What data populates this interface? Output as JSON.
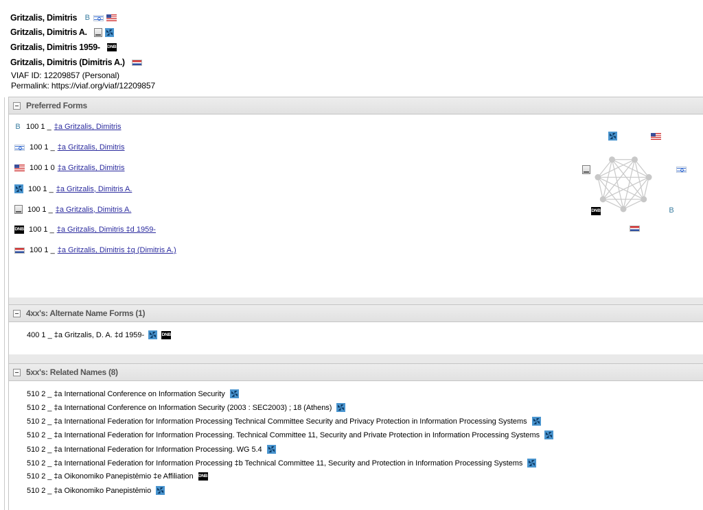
{
  "header": {
    "names": [
      {
        "text": "Gritzalis, Dimitris",
        "icons": [
          "b-icon",
          "israel-flag-icon",
          "usa-flag-icon"
        ]
      },
      {
        "text": "Gritzalis, Dimitris A.",
        "icons": [
          "book-icon",
          "lc-icon"
        ]
      },
      {
        "text": "Gritzalis, Dimitris 1959-",
        "icons": [
          "dnb-icon"
        ]
      },
      {
        "text": "Gritzalis, Dimitris (Dimitris A.)",
        "icons": [
          "netherlands-flag-icon"
        ]
      }
    ],
    "viaf_id": "VIAF ID: 12209857 (Personal)",
    "permalink": "Permalink: https://viaf.org/viaf/12209857"
  },
  "preferred_forms": {
    "title": "Preferred Forms",
    "rows": [
      {
        "icon": "b-icon",
        "code": "100 1 _",
        "link": "‡a  Gritzalis, Dimitris"
      },
      {
        "icon": "israel-flag-icon",
        "code": "100 1 _",
        "link": "‡a  Gritzalis, Dimitris"
      },
      {
        "icon": "usa-flag-icon",
        "code": "100 1 0",
        "link": "‡a  Gritzalis, Dimitris"
      },
      {
        "icon": "lc-icon",
        "code": "100 1 _",
        "link": "‡a  Gritzalis, Dimitris A."
      },
      {
        "icon": "book-icon",
        "code": "100 1 _",
        "link": "‡a  Gritzalis, Dimitris A."
      },
      {
        "icon": "dnb-icon",
        "code": "100 1 _",
        "link": "‡a  Gritzalis, Dimitris ‡d  1959-"
      },
      {
        "icon": "netherlands-flag-icon",
        "code": "100 1 _",
        "link": "‡a  Gritzalis, Dimitris ‡q  (Dimitris A.)"
      }
    ],
    "graph": {
      "b_label": "B",
      "dnb_label": "DNB"
    }
  },
  "alternate_names": {
    "title": "4xx's: Alternate Name Forms (1)",
    "rows": [
      {
        "text": "400 1 _ ‡a  Gritzalis, D. A. ‡d  1959-",
        "icons": [
          "lc-icon",
          "dnb-icon"
        ]
      }
    ]
  },
  "related_names": {
    "title": "5xx's: Related Names (8)",
    "rows": [
      {
        "text": "510 2 _ ‡a  International Conference on Information Security",
        "icon": "lc-icon"
      },
      {
        "text": "510 2 _ ‡a  International Conference on Information Security (2003 : SEC2003) ; 18 (Athens)",
        "icon": "lc-icon"
      },
      {
        "text": "510 2 _ ‡a  International Federation for Information Processing Technical Committee Security and Privacy Protection in Information Processing Systems",
        "icon": "lc-icon"
      },
      {
        "text": "510 2 _ ‡a  International Federation for Information Processing. Technical Committee 11, Security and Private Protection in Information Processing Systems",
        "icon": "lc-icon"
      },
      {
        "text": "510 2 _ ‡a  International Federation for Information Processing. WG 5.4",
        "icon": "lc-icon"
      },
      {
        "text": "510 2 _ ‡a  International Federation for Information Processing ‡b  Technical Committee 11, Security and Protection in Information Processing Systems",
        "icon": "lc-icon"
      },
      {
        "text": "510 2 _ ‡a  Oikonomiko Panepistēmio ‡e  Affiliation",
        "icon": "dnb-icon"
      },
      {
        "text": "510 2 _ ‡a  Oikonomiko Panepistēmio",
        "icon": "lc-icon"
      }
    ]
  }
}
